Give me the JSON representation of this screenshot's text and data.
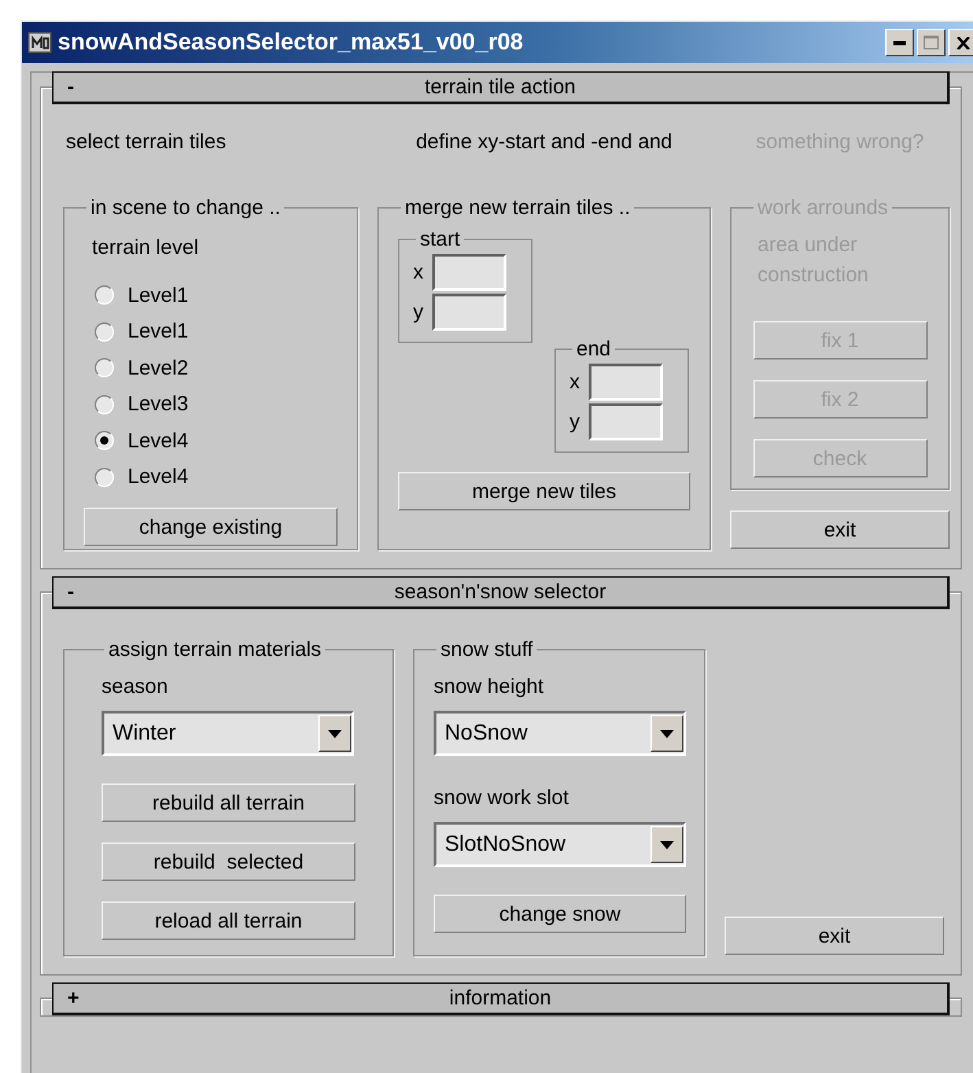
{
  "window": {
    "title": "snowAndSeasonSelector_max51_v00_r08"
  },
  "terrain_rollout": {
    "toggle": "-",
    "title": "terrain tile action",
    "select": {
      "heading": "select terrain tiles",
      "group": "in scene to change ..",
      "label": "terrain level",
      "levels": [
        {
          "label": "Level1",
          "selected": false
        },
        {
          "label": "Level1",
          "selected": false
        },
        {
          "label": "Level2",
          "selected": false
        },
        {
          "label": "Level3",
          "selected": false
        },
        {
          "label": "Level4",
          "selected": true
        },
        {
          "label": "Level4",
          "selected": false
        }
      ],
      "button": "change existing"
    },
    "merge": {
      "heading": "define xy-start and -end and",
      "group": "merge new terrain tiles ..",
      "start": {
        "label": "start",
        "fields": [
          {
            "label": "x"
          },
          {
            "label": "y"
          }
        ]
      },
      "end": {
        "label": "end",
        "fields": [
          {
            "label": "x"
          },
          {
            "label": "y"
          }
        ]
      },
      "button": "merge new tiles"
    },
    "fix": {
      "heading": "something wrong?",
      "group": "work arrounds",
      "note": "area under construction",
      "disabled": true,
      "buttons": [
        "fix 1",
        "fix 2",
        "check"
      ]
    },
    "exit": "exit"
  },
  "season_rollout": {
    "toggle": "-",
    "title": "season'n'snow selector",
    "materials": {
      "group": "assign terrain materials",
      "label": "season",
      "dropdown": "Winter",
      "buttons": [
        "rebuild all terrain",
        "rebuild  selected",
        "reload all terrain"
      ]
    },
    "snow": {
      "group": "snow stuff",
      "height_label": "snow height",
      "height_dropdown": "NoSnow",
      "slot_label": "snow work slot",
      "slot_dropdown": "SlotNoSnow",
      "button": "change snow"
    },
    "exit": "exit"
  },
  "info_rollout": {
    "toggle": "+",
    "title": "information"
  }
}
